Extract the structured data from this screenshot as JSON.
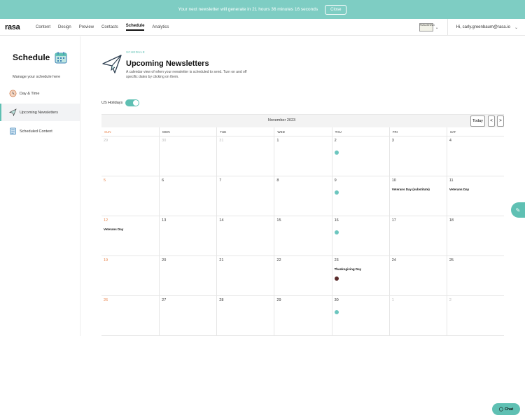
{
  "banner": {
    "text": "Your next newsletter will generate in 21 hours 36 minutes 16 seconds",
    "close_label": "Close"
  },
  "nav": {
    "logo": "rasa",
    "items": [
      {
        "label": "Content"
      },
      {
        "label": "Design"
      },
      {
        "label": "Preview"
      },
      {
        "label": "Contacts"
      },
      {
        "label": "Schedule",
        "active": true
      },
      {
        "label": "Analytics"
      }
    ],
    "publisher": "PUBLISHING",
    "user": "Hi, carly.greenbaum@rasa.io"
  },
  "sidebar": {
    "title": "Schedule",
    "subtitle": "Manage your schedule here",
    "items": [
      {
        "label": "Day & Time",
        "icon": "clock-icon"
      },
      {
        "label": "Upcoming Newsletters",
        "icon": "paper-plane-icon",
        "active": true
      },
      {
        "label": "Scheduled Content",
        "icon": "checklist-icon"
      }
    ]
  },
  "header": {
    "crumb": "SCHEDULE",
    "title": "Upcoming Newsletters",
    "description": "A calendar view of when your newsletter is scheduled to send. Turn on and off specific dates by clicking on them."
  },
  "holidays": {
    "label": "US Holidays",
    "enabled": true
  },
  "calendar": {
    "month": "November 2023",
    "today_label": "Today",
    "prev": "<",
    "next": ">",
    "days": [
      "SUN",
      "MON",
      "TUE",
      "WED",
      "THU",
      "FRI",
      "SAT"
    ],
    "weeks": [
      [
        {
          "d": "29",
          "out": true
        },
        {
          "d": "30",
          "out": true
        },
        {
          "d": "31",
          "out": true
        },
        {
          "d": "1"
        },
        {
          "d": "2",
          "dot": true
        },
        {
          "d": "3"
        },
        {
          "d": "4"
        }
      ],
      [
        {
          "d": "5"
        },
        {
          "d": "6"
        },
        {
          "d": "7"
        },
        {
          "d": "8"
        },
        {
          "d": "9",
          "dot": true
        },
        {
          "d": "10",
          "ev": "Veterans Day (substitute)"
        },
        {
          "d": "11",
          "ev": "Veterans Day"
        }
      ],
      [
        {
          "d": "12",
          "ev": "Veterans Day"
        },
        {
          "d": "13"
        },
        {
          "d": "14"
        },
        {
          "d": "15"
        },
        {
          "d": "16",
          "dot": true
        },
        {
          "d": "17"
        },
        {
          "d": "18"
        }
      ],
      [
        {
          "d": "19"
        },
        {
          "d": "20"
        },
        {
          "d": "21"
        },
        {
          "d": "22"
        },
        {
          "d": "23",
          "ev": "Thanksgiving Day",
          "dark": true
        },
        {
          "d": "24"
        },
        {
          "d": "25"
        }
      ],
      [
        {
          "d": "26"
        },
        {
          "d": "27"
        },
        {
          "d": "28"
        },
        {
          "d": "29"
        },
        {
          "d": "30",
          "dot": true
        },
        {
          "d": "1",
          "out": true
        },
        {
          "d": "2",
          "out": true
        }
      ]
    ]
  },
  "chat": {
    "label": "Chat"
  },
  "colors": {
    "accent": "#5fc0b3",
    "banner": "#7ecdc3",
    "sunday": "#e8824a"
  }
}
